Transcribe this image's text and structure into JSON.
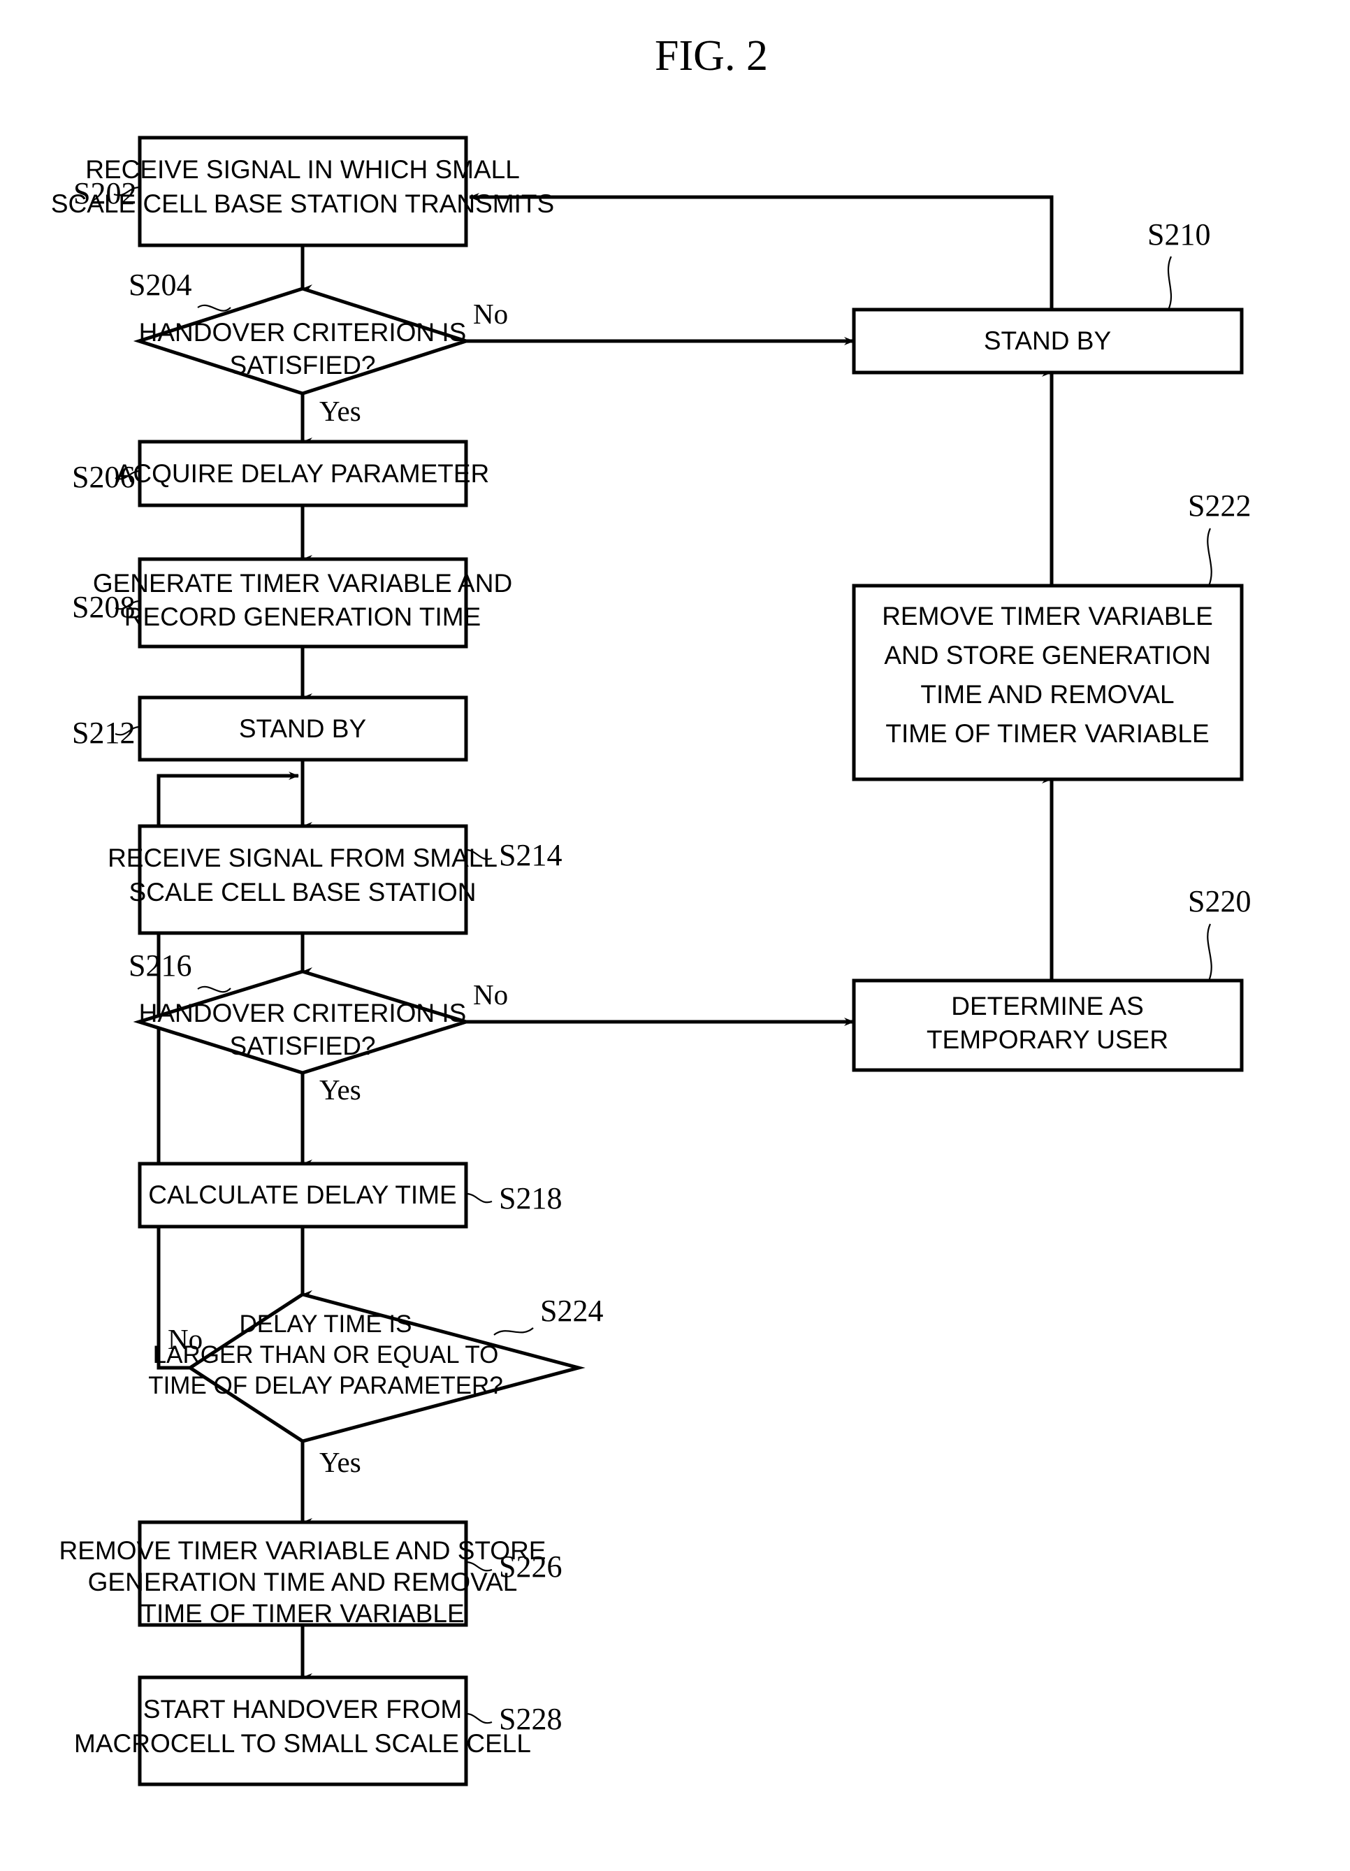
{
  "figure": {
    "title": "FIG. 2"
  },
  "nodes": {
    "s202": {
      "id": "S202",
      "shape": "process",
      "lines": [
        "RECEIVE SIGNAL IN WHICH SMALL",
        "SCALE CELL BASE STATION TRANSMITS"
      ]
    },
    "s204": {
      "id": "S204",
      "shape": "decision",
      "lines": [
        "HANDOVER CRITERION IS",
        "SATISFIED?"
      ],
      "branch_no": "No",
      "branch_yes": "Yes"
    },
    "s206": {
      "id": "S206",
      "shape": "process",
      "lines": [
        "ACQUIRE DELAY PARAMETER"
      ]
    },
    "s208": {
      "id": "S208",
      "shape": "process",
      "lines": [
        "GENERATE TIMER VARIABLE AND",
        "RECORD GENERATION TIME"
      ]
    },
    "s210": {
      "id": "S210",
      "shape": "process",
      "lines": [
        "STAND BY"
      ]
    },
    "s212": {
      "id": "S212",
      "shape": "process",
      "lines": [
        "STAND BY"
      ]
    },
    "s214": {
      "id": "S214",
      "shape": "process",
      "lines": [
        "RECEIVE SIGNAL FROM SMALL",
        "SCALE CELL BASE STATION"
      ]
    },
    "s216": {
      "id": "S216",
      "shape": "decision",
      "lines": [
        "HANDOVER CRITERION IS",
        "SATISFIED?"
      ],
      "branch_no": "No",
      "branch_yes": "Yes"
    },
    "s218": {
      "id": "S218",
      "shape": "process",
      "lines": [
        "CALCULATE DELAY TIME"
      ]
    },
    "s220": {
      "id": "S220",
      "shape": "process",
      "lines": [
        "DETERMINE AS",
        "TEMPORARY USER"
      ]
    },
    "s222": {
      "id": "S222",
      "shape": "process",
      "lines": [
        "REMOVE TIMER VARIABLE",
        "AND STORE GENERATION",
        "TIME AND REMOVAL",
        "TIME OF TIMER VARIABLE"
      ]
    },
    "s224": {
      "id": "S224",
      "shape": "decision",
      "lines": [
        "DELAY TIME IS",
        "LARGER THAN OR EQUAL TO",
        "TIME OF DELAY PARAMETER?"
      ],
      "branch_no": "No",
      "branch_yes": "Yes"
    },
    "s226": {
      "id": "S226",
      "shape": "process",
      "lines": [
        "REMOVE TIMER VARIABLE AND STORE",
        "GENERATION TIME AND REMOVAL",
        "TIME OF TIMER VARIABLE"
      ]
    },
    "s228": {
      "id": "S228",
      "shape": "process",
      "lines": [
        "START HANDOVER FROM",
        "MACROCELL TO SMALL SCALE CELL"
      ]
    }
  },
  "colors": {
    "ink": "#000000",
    "paper": "#ffffff"
  }
}
